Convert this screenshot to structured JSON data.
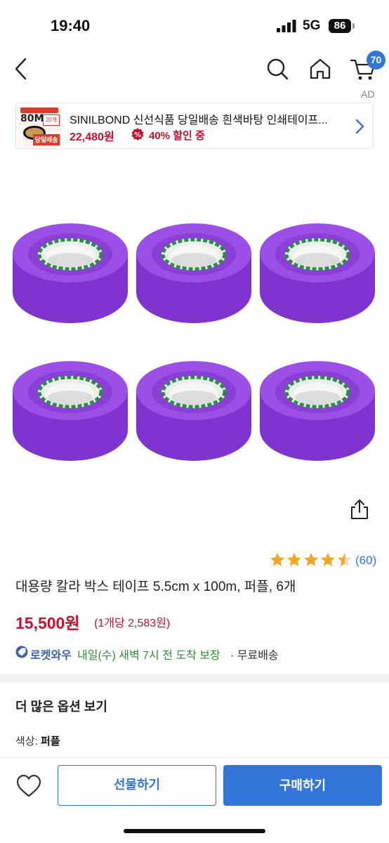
{
  "status_bar": {
    "time": "19:40",
    "network": "5G",
    "battery": "86"
  },
  "top_nav": {
    "cart_count": "70"
  },
  "ad": {
    "label": "AD",
    "title": "SINILBOND 신선식품 당일배송 흰색바탕 인쇄테이프...",
    "price": "22,480원",
    "discount": "40% 할인 중",
    "thumb_text": {
      "length": "80M",
      "count": "20개",
      "promo": "당일배송"
    }
  },
  "product": {
    "rating": 4.5,
    "review_count": "(60)",
    "title": "대용량 칼라 박스 테이프 5.5cm x 100m, 퍼플, 6개",
    "price": "15,500원",
    "unit_price": "(1개당 2,583원)",
    "tape_color": "#8a3fd6",
    "quantity_shown": 6
  },
  "delivery": {
    "badge": "로켓와우",
    "arrival": "내일(수) 새벽 7시 전 도착 보장",
    "shipping": "· 무료배송"
  },
  "options": {
    "header": "더 많은 옵션 보기",
    "color_label": "색상: ",
    "color_value": "퍼플"
  },
  "bottom_bar": {
    "gift_label": "선물하기",
    "buy_label": "구매하기"
  },
  "colors": {
    "accent": "#3476d8",
    "price_red": "#c8102e",
    "delivery_green": "#2e8b3a"
  }
}
